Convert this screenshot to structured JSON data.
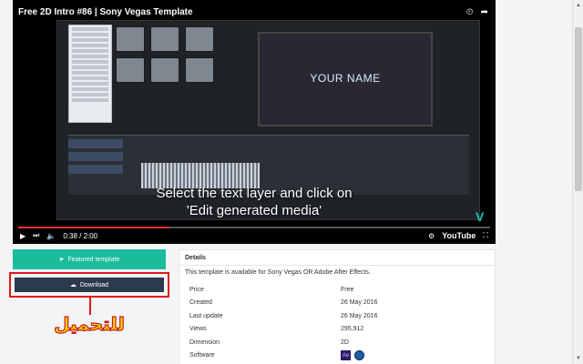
{
  "video": {
    "title": "Free 2D Intro #86 | Sony Vegas Template",
    "preview_text": "YOUR NAME",
    "subtitle_line1": "Select the text layer and click on",
    "subtitle_line2": "'Edit generated media'",
    "time": "0:38 / 2:00",
    "progress": 0.32,
    "youtube_label": "YouTube"
  },
  "buttons": {
    "featured_label": "Featured template",
    "download_label": "Download"
  },
  "annotation": {
    "arabic_text": "للتحميل"
  },
  "details": {
    "heading": "Details",
    "description": "This template is available for Sony Vegas OR Adobe After Effects.",
    "rows": [
      {
        "label": "Price",
        "value": "Free"
      },
      {
        "label": "Created",
        "value": "26 May 2016"
      },
      {
        "label": "Last update",
        "value": "26 May 2016"
      },
      {
        "label": "Views",
        "value": "295,912"
      },
      {
        "label": "Dimension",
        "value": "2D"
      },
      {
        "label": "Software",
        "value": ""
      }
    ],
    "software_icons": {
      "ae_text": "Ae"
    }
  },
  "colors": {
    "featured": "#1bbc9c",
    "download": "#2c3a4e",
    "annotation_red": "#e01818",
    "annotation_yellow": "#ffd200"
  }
}
